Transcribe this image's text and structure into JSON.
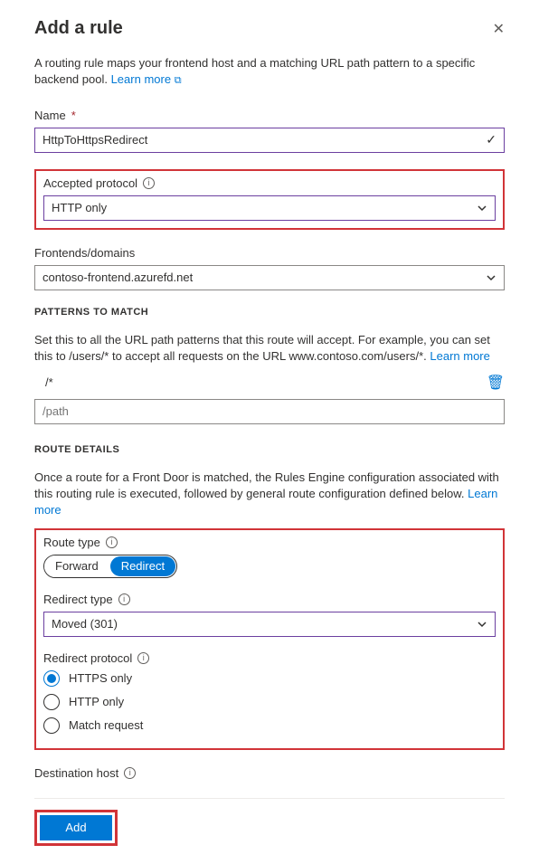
{
  "header": {
    "title": "Add a rule"
  },
  "intro": {
    "text": "A routing rule maps your frontend host and a matching URL path pattern to a specific backend pool. ",
    "learn_more": "Learn more"
  },
  "name_field": {
    "label": "Name",
    "value": "HttpToHttpsRedirect"
  },
  "accepted_protocol": {
    "label": "Accepted protocol",
    "value": "HTTP only"
  },
  "frontends": {
    "label": "Frontends/domains",
    "value": "contoso-frontend.azurefd.net"
  },
  "patterns": {
    "heading": "PATTERNS TO MATCH",
    "desc": "Set this to all the URL path patterns that this route will accept. For example, you can set this to /users/* to accept all requests on the URL www.contoso.com/users/*. ",
    "learn_more": "Learn more",
    "items": [
      "/*"
    ],
    "placeholder": "/path"
  },
  "route_details": {
    "heading": "ROUTE DETAILS",
    "desc": "Once a route for a Front Door is matched, the Rules Engine configuration associated with this routing rule is executed, followed by general route configuration defined below. ",
    "learn_more": "Learn more"
  },
  "route_type": {
    "label": "Route type",
    "options": [
      "Forward",
      "Redirect"
    ],
    "selected": "Redirect"
  },
  "redirect_type": {
    "label": "Redirect type",
    "value": "Moved (301)"
  },
  "redirect_protocol": {
    "label": "Redirect protocol",
    "options": [
      "HTTPS only",
      "HTTP only",
      "Match request"
    ],
    "selected": "HTTPS only"
  },
  "destination_host": {
    "label": "Destination host"
  },
  "footer": {
    "add": "Add"
  }
}
